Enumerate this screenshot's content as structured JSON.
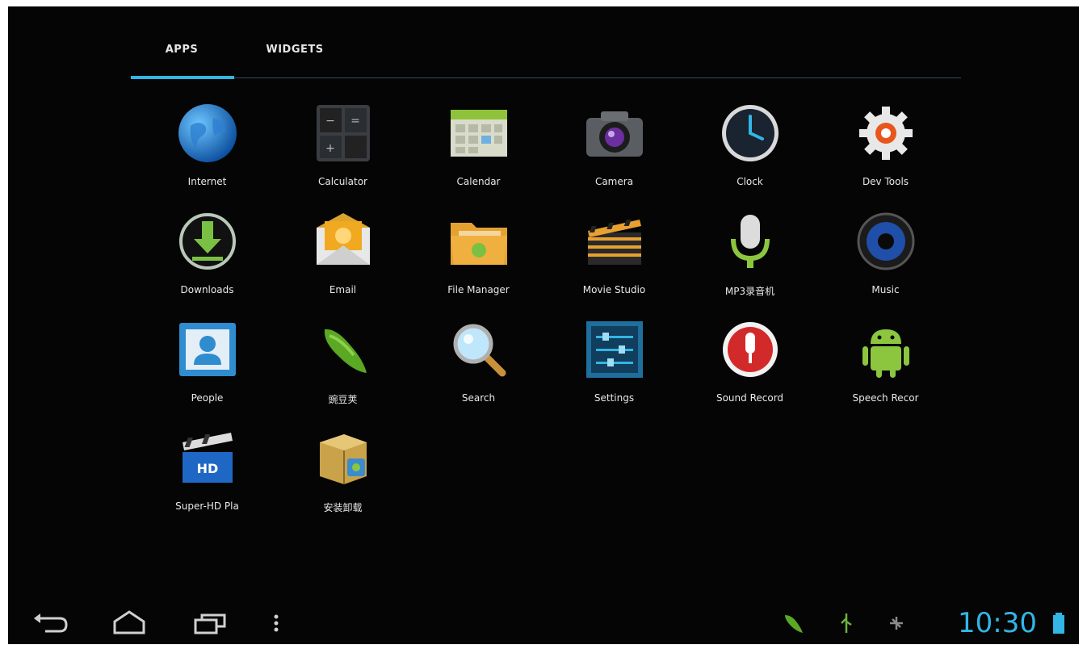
{
  "tabs": {
    "apps": "APPS",
    "widgets": "WIDGETS"
  },
  "apps": [
    {
      "label": "Internet",
      "icon": "globe-icon"
    },
    {
      "label": "Calculator",
      "icon": "calculator-icon"
    },
    {
      "label": "Calendar",
      "icon": "calendar-icon"
    },
    {
      "label": "Camera",
      "icon": "camera-icon"
    },
    {
      "label": "Clock",
      "icon": "clock-icon"
    },
    {
      "label": "Dev Tools",
      "icon": "gear-icon"
    },
    {
      "label": "Downloads",
      "icon": "download-icon"
    },
    {
      "label": "Email",
      "icon": "email-icon"
    },
    {
      "label": "File Manager",
      "icon": "folder-icon"
    },
    {
      "label": "Movie Studio",
      "icon": "film-icon"
    },
    {
      "label": "MP3录音机",
      "icon": "microphone-icon"
    },
    {
      "label": "Music",
      "icon": "music-speaker-icon"
    },
    {
      "label": "People",
      "icon": "contacts-icon"
    },
    {
      "label": "豌豆荚",
      "icon": "pea-pod-icon"
    },
    {
      "label": "Search",
      "icon": "magnifier-icon"
    },
    {
      "label": "Settings",
      "icon": "settings-icon"
    },
    {
      "label": "Sound Record",
      "icon": "sound-recorder-icon"
    },
    {
      "label": "Speech Recor",
      "icon": "android-robot-icon"
    },
    {
      "label": "Super-HD Pla",
      "icon": "video-player-icon"
    },
    {
      "label": "安装卸载",
      "icon": "package-installer-icon"
    }
  ],
  "status": {
    "time": "10:30"
  },
  "colors": {
    "accent": "#33b5e5",
    "background": "#050505"
  }
}
